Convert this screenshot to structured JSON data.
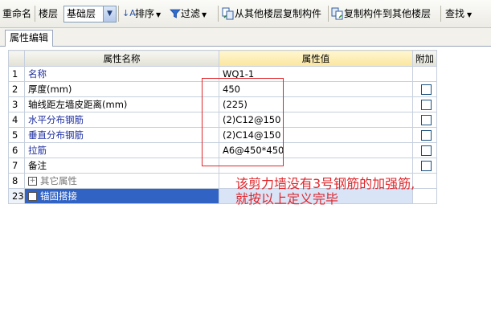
{
  "toolbar": {
    "rename": "重命名",
    "floor_label": "楼层",
    "floor_value": "基础层",
    "sort": "排序",
    "filter": "过滤",
    "copy_from": "从其他楼层复制构件",
    "copy_to": "复制构件到其他楼层",
    "find": "查找"
  },
  "tab": "属性编辑",
  "grid": {
    "col_name": "属性名称",
    "col_value": "属性值",
    "col_extra": "附加",
    "rows": [
      {
        "idx": "1",
        "name": "名称",
        "value": "WQ1-1",
        "check": false,
        "blue": true
      },
      {
        "idx": "2",
        "name": "厚度(mm)",
        "value": "450",
        "check": true,
        "blue": false
      },
      {
        "idx": "3",
        "name": "轴线距左墙皮距离(mm)",
        "value": "(225)",
        "check": true,
        "blue": false
      },
      {
        "idx": "4",
        "name": "水平分布钢筋",
        "value": "(2)C12@150",
        "check": true,
        "blue": true
      },
      {
        "idx": "5",
        "name": "垂直分布钢筋",
        "value": "(2)C14@150",
        "check": true,
        "blue": true
      },
      {
        "idx": "6",
        "name": "拉筋",
        "value": "A6@450*450",
        "check": true,
        "blue": true
      },
      {
        "idx": "7",
        "name": "备注",
        "value": "",
        "check": true,
        "blue": false
      },
      {
        "idx": "8",
        "name": "其它属性",
        "value": "",
        "check": false,
        "blue": false
      },
      {
        "idx": "23",
        "name": "锚固搭接",
        "value": "",
        "check": false,
        "blue": false
      }
    ]
  },
  "annotation": {
    "line1": "该剪力墙没有3号钢筋的加强筋,",
    "line2": "就按以上定义完毕",
    "color": "#e0262b"
  }
}
